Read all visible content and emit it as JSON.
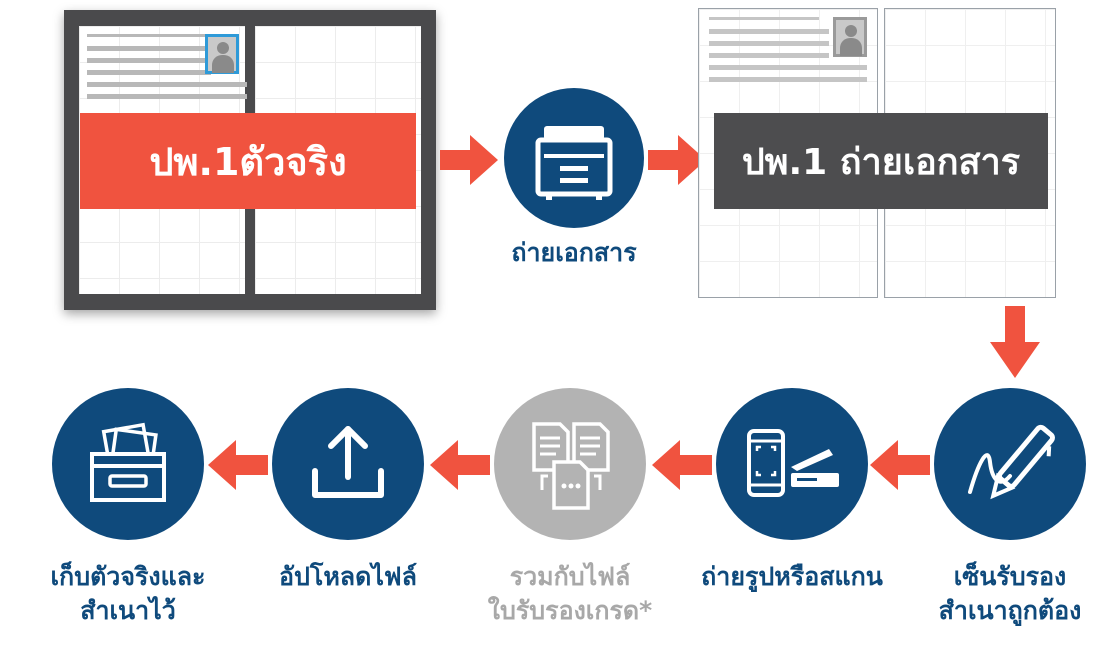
{
  "original_banner": "ปพ.1ตัวจริง",
  "copy_banner": "ปพ.1 ถ่ายเอกสาร",
  "steps": {
    "photocopy": "ถ่ายเอกสาร",
    "sign_certify": [
      "เซ็นรับรอง",
      "สำเนาถูกต้อง"
    ],
    "photo_scan": "ถ่ายรูปหรือสแกน",
    "combine": [
      "รวมกับไฟล์",
      "ใบรับรองเกรด*"
    ],
    "upload": "อัปโหลดไฟล์",
    "keep": [
      "เก็บตัวจริงและ",
      "สำเนาไว้"
    ]
  },
  "colors": {
    "navy": "#0f4a7c",
    "red": "#f0533f",
    "gray": "#b3b3b3",
    "dark_gray": "#4d4d4f"
  },
  "icons": [
    "photocopier-icon",
    "signature-pen-icon",
    "phone-scanner-icon",
    "documents-icon",
    "upload-icon",
    "archive-box-icon"
  ]
}
